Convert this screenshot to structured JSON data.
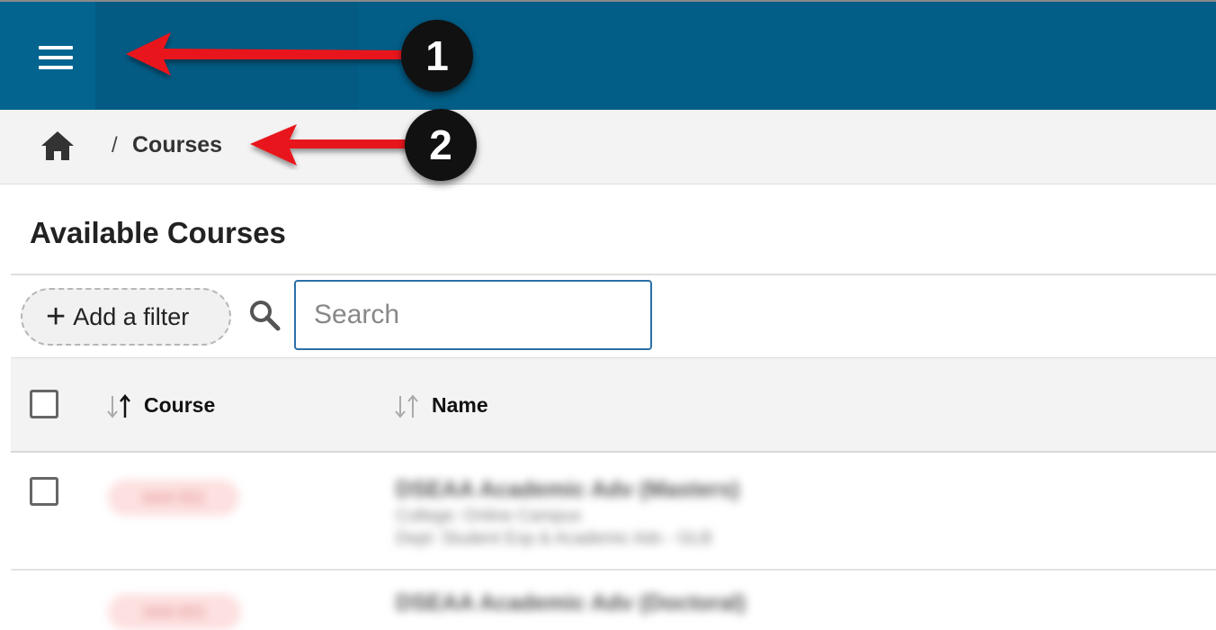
{
  "annotations": {
    "badge_1": "1",
    "badge_2": "2"
  },
  "breadcrumb": {
    "separator": "/",
    "current": "Courses"
  },
  "page": {
    "title": "Available Courses"
  },
  "toolbar": {
    "filter_plus": "+",
    "filter_label": "Add a filter",
    "search_placeholder": "Search"
  },
  "table": {
    "columns": [
      "Course",
      "Name"
    ],
    "rows": [
      {
        "course": "AAA 501",
        "name": "DSEAA Academic Adv (Masters)",
        "college_label": "College:",
        "college": "Online Campus",
        "dept_label": "Dept:",
        "dept": "Student Exp & Academic Adv - GLB"
      },
      {
        "course": "AAA 601",
        "name": "DSEAA Academic Adv (Doctoral)"
      }
    ]
  },
  "colors": {
    "topbar": "#025e87",
    "crumbbar": "#f3f3f3",
    "search_border": "#2b6fa8",
    "arrow": "#e8141a"
  }
}
